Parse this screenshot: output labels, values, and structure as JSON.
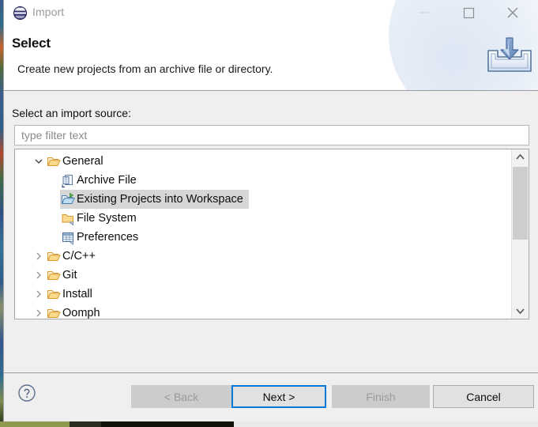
{
  "window": {
    "title": "Import",
    "app_icon": "eclipse-icon",
    "controls": {
      "minimize": {
        "name": "minimize-button",
        "glyph": "minimize-icon",
        "enabled": false
      },
      "maximize": {
        "name": "maximize-button",
        "glyph": "maximize-icon",
        "enabled": true
      },
      "close": {
        "name": "close-button",
        "glyph": "close-icon",
        "enabled": true
      }
    }
  },
  "header": {
    "title": "Select",
    "description": "Create new projects from an archive file or directory.",
    "banner_icon": "import-tray-icon"
  },
  "main": {
    "source_label": "Select an import source:",
    "filter": {
      "value": "",
      "placeholder": "type filter text"
    },
    "tree": {
      "selected": "Existing Projects into Workspace",
      "items": [
        {
          "label": "General",
          "icon": "folder-open-icon",
          "depth": 0,
          "expander": "chevron-down-icon",
          "selected": false
        },
        {
          "label": "Archive File",
          "icon": "archive-file-icon",
          "depth": 1,
          "expander": "",
          "selected": false
        },
        {
          "label": "Existing Projects into Workspace",
          "icon": "projects-import-icon",
          "depth": 1,
          "expander": "",
          "selected": true
        },
        {
          "label": "File System",
          "icon": "folder-icon",
          "depth": 1,
          "expander": "",
          "selected": false
        },
        {
          "label": "Preferences",
          "icon": "preferences-table-icon",
          "depth": 1,
          "expander": "",
          "selected": false
        },
        {
          "label": "C/C++",
          "icon": "folder-open-icon",
          "depth": 0,
          "expander": "chevron-right-icon",
          "selected": false
        },
        {
          "label": "Git",
          "icon": "folder-open-icon",
          "depth": 0,
          "expander": "chevron-right-icon",
          "selected": false
        },
        {
          "label": "Install",
          "icon": "folder-open-icon",
          "depth": 0,
          "expander": "chevron-right-icon",
          "selected": false
        },
        {
          "label": "Oomph",
          "icon": "folder-open-icon",
          "depth": 0,
          "expander": "chevron-right-icon",
          "selected": false
        }
      ],
      "scrollbar": {
        "up_icon": "scroll-up-icon",
        "down_icon": "scroll-down-icon",
        "thumb_position": "top"
      }
    }
  },
  "footer": {
    "help_icon": "help-question-icon",
    "buttons": [
      {
        "id": "back",
        "label": "< Back",
        "state": "disabled"
      },
      {
        "id": "next",
        "label": "Next >",
        "state": "default"
      },
      {
        "id": "finish",
        "label": "Finish",
        "state": "disabled"
      },
      {
        "id": "cancel",
        "label": "Cancel",
        "state": "normal"
      }
    ]
  },
  "colors": {
    "accent": "#0078d7",
    "dialog_bg": "#efefef",
    "header_bg": "#ffffff",
    "selection": "#d6d6d6",
    "folder": "#e8a33d",
    "disabled_text": "#9a9a9a"
  }
}
